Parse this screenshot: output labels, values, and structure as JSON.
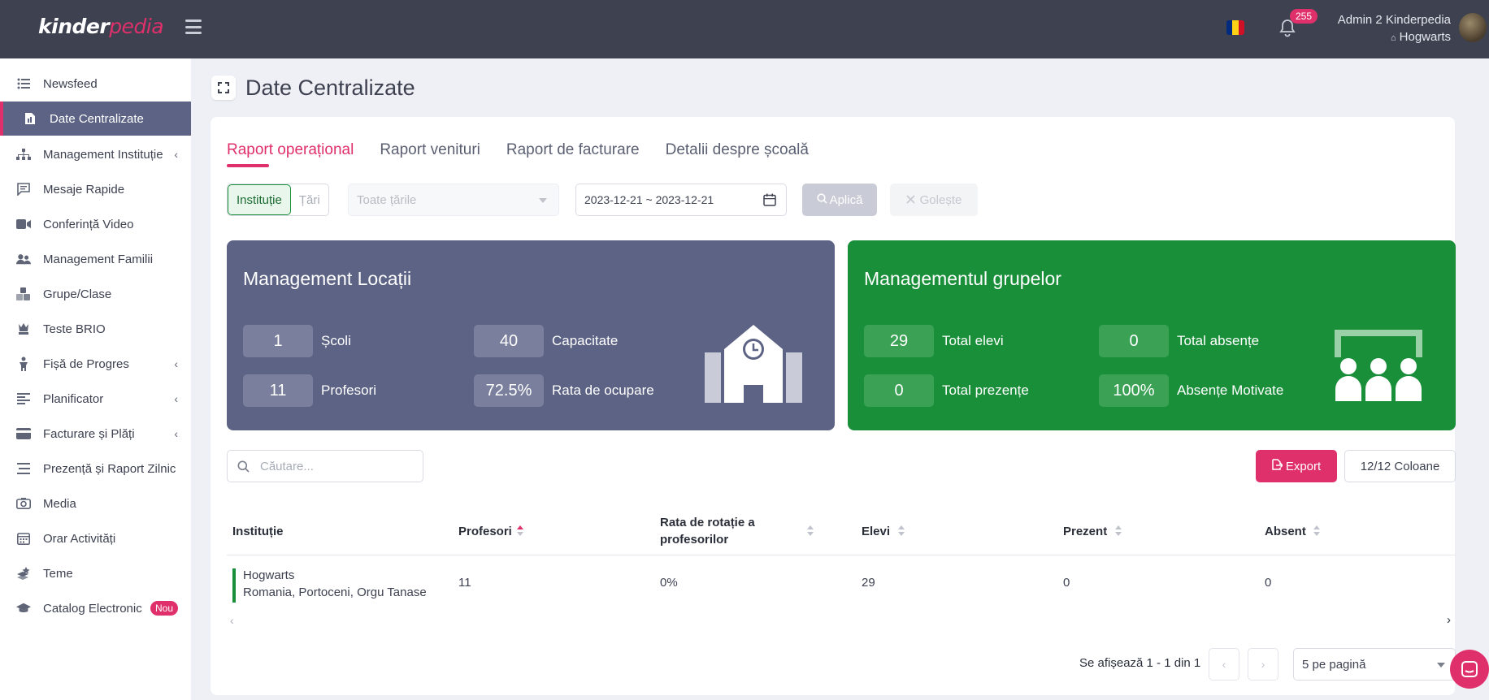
{
  "app": {
    "logo_main": "kinder",
    "logo_accent": "pedia"
  },
  "header": {
    "notifications": "255",
    "user_name": "Admin 2 Kinderpedia",
    "school": "Hogwarts",
    "flag_colors": [
      "#002B7F",
      "#FCD116",
      "#CE1126"
    ]
  },
  "sidebar": {
    "items": [
      {
        "label": "Newsfeed"
      },
      {
        "label": "Date Centralizate"
      },
      {
        "label": "Management Instituție"
      },
      {
        "label": "Mesaje Rapide"
      },
      {
        "label": "Conferință Video"
      },
      {
        "label": "Management Familii"
      },
      {
        "label": "Grupe/Clase"
      },
      {
        "label": "Teste BRIO"
      },
      {
        "label": "Fișă de Progres"
      },
      {
        "label": "Planificator"
      },
      {
        "label": "Facturare și Plăți"
      },
      {
        "label": "Prezență și Raport Zilnic"
      },
      {
        "label": "Media"
      },
      {
        "label": "Orar Activități"
      },
      {
        "label": "Teme"
      },
      {
        "label": "Catalog Electronic",
        "badge": "Nou"
      }
    ]
  },
  "page": {
    "title": "Date Centralizate"
  },
  "tabs": [
    "Raport operațional",
    "Raport venituri",
    "Raport de facturare",
    "Detalii despre școală"
  ],
  "filters": {
    "seg_institution": "Instituție",
    "seg_countries": "Țări",
    "countries_placeholder": "Toate țările",
    "date_range": "2023-12-21  ~  2023-12-21",
    "apply": "Aplică",
    "clear": "Golește"
  },
  "locations": {
    "title": "Management Locații",
    "stats": [
      {
        "value": "1",
        "label": "Școli"
      },
      {
        "value": "40",
        "label": "Capacitate"
      },
      {
        "value": "11",
        "label": "Profesori"
      },
      {
        "value": "72.5%",
        "label": "Rata de ocupare"
      }
    ]
  },
  "groups": {
    "title": "Managementul grupelor",
    "stats": [
      {
        "value": "29",
        "label": "Total elevi"
      },
      {
        "value": "0",
        "label": "Total absențe"
      },
      {
        "value": "0",
        "label": "Total prezențe"
      },
      {
        "value": "100%",
        "label": "Absențe Motivate"
      }
    ]
  },
  "table_tools": {
    "search_placeholder": "Căutare...",
    "export": "Export",
    "columns": "12/12 Coloane"
  },
  "table": {
    "headers": [
      "Instituție",
      "Profesori",
      "Rata de rotație a profesorilor",
      "Elevi",
      "Prezent",
      "Absent"
    ],
    "rows": [
      {
        "institution": "Hogwarts",
        "location": "Romania, Portoceni, Orgu Tanase",
        "teachers": "11",
        "rotation": "0%",
        "students": "29",
        "present": "0",
        "absent": "0"
      }
    ]
  },
  "pagination": {
    "info": "Se afișează 1 - 1 din 1",
    "per_page": "5 pe pagină"
  }
}
